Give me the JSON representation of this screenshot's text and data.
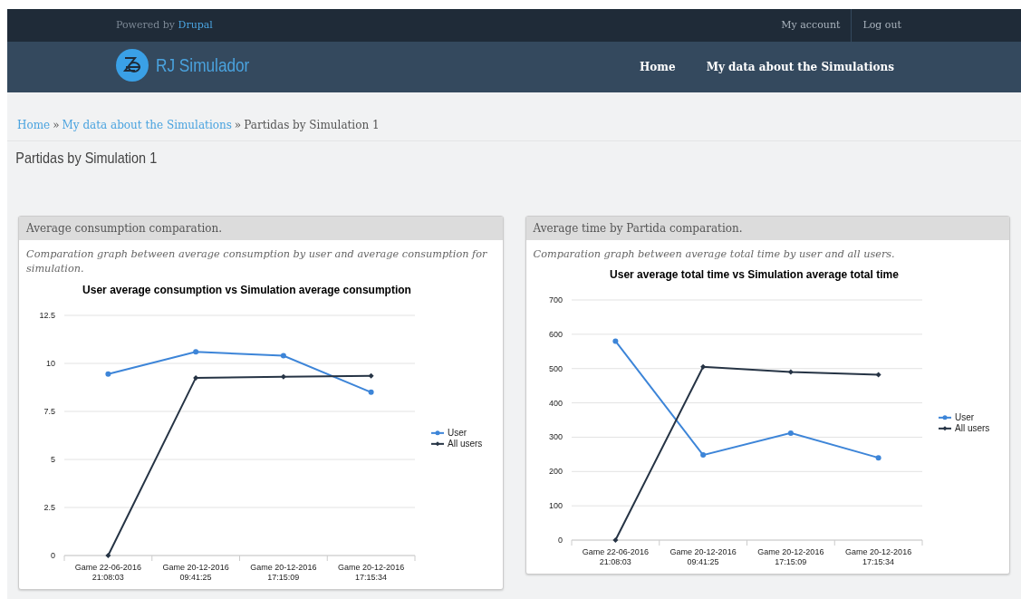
{
  "header": {
    "powered_by": "Powered by",
    "powered_link": "Drupal",
    "user_menu": [
      {
        "label": "My account"
      },
      {
        "label": "Log out"
      }
    ],
    "site_name": "RJ Simulador",
    "main_menu": [
      {
        "label": "Home"
      },
      {
        "label": "My data about the Simulations"
      }
    ]
  },
  "breadcrumb_separator": "»",
  "breadcrumb": [
    {
      "label": "Home",
      "link": true
    },
    {
      "label": "My data about the Simulations",
      "link": true
    },
    {
      "label": "Partidas by Simulation 1",
      "link": false
    }
  ],
  "page_title": "Partidas by Simulation 1",
  "panels": [
    {
      "heading": "Average consumption comparation.",
      "description": "Comparation graph between average consumption by user and average consumption for simulation.",
      "chart_data": {
        "type": "line",
        "title": "User average consumption vs Simulation average consumption",
        "categories": [
          "Game 22-06-2016 21:08:03",
          "Game 20-12-2016 09:41:25",
          "Game 20-12-2016 17:15:09",
          "Game 20-12-2016 17:15:34"
        ],
        "series": [
          {
            "name": "User",
            "color": "#3d85d8",
            "marker": "circle",
            "values": [
              9.45,
              10.6,
              10.4,
              8.5
            ]
          },
          {
            "name": "All users",
            "color": "#263445",
            "marker": "diamond",
            "values": [
              0,
              9.25,
              9.3,
              9.35
            ]
          }
        ],
        "grid": true,
        "ylim": [
          0,
          12.5
        ],
        "legend": "right",
        "yticks": [
          0,
          {
            "value": 2.5,
            "label": "2.5"
          },
          5,
          {
            "value": 7.5,
            "label": "7.5"
          },
          10,
          {
            "value": 12.5,
            "label": "12.5"
          }
        ]
      }
    },
    {
      "heading": "Average time by Partida comparation.",
      "description": "Comparation graph between average total time by user and all users.",
      "chart_data": {
        "type": "line",
        "title": "User average total time vs Simulation average total time",
        "categories": [
          "Game 22-06-2016 21:08:03",
          "Game 20-12-2016 09:41:25",
          "Game 20-12-2016 17:15:09",
          "Game 20-12-2016 17:15:34"
        ],
        "series": [
          {
            "name": "User",
            "color": "#3d85d8",
            "marker": "circle",
            "values": [
              580,
              248,
              312,
              240
            ]
          },
          {
            "name": "All users",
            "color": "#263445",
            "marker": "diamond",
            "values": [
              0,
              505,
              490,
              482
            ]
          }
        ],
        "grid": true,
        "ylim": [
          0,
          700
        ],
        "legend": "right",
        "yticks": [
          0,
          100,
          200,
          300,
          400,
          500,
          600,
          700
        ]
      }
    }
  ]
}
